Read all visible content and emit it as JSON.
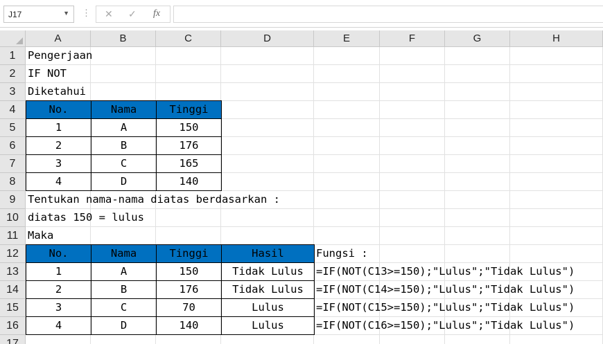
{
  "formula_bar": {
    "name_box": "J17",
    "cancel_icon": "✕",
    "enter_icon": "✓",
    "fx_label": "fx",
    "formula": ""
  },
  "columns": [
    "A",
    "B",
    "C",
    "D",
    "E",
    "F",
    "G",
    "H"
  ],
  "rows": [
    "1",
    "2",
    "3",
    "4",
    "5",
    "6",
    "7",
    "8",
    "9",
    "10",
    "11",
    "12",
    "13",
    "14",
    "15",
    "16",
    "17"
  ],
  "texts": {
    "r1": "Pengerjaan",
    "r2": "IF NOT",
    "r3": "Diketahui",
    "r9": "Tentukan nama-nama diatas berdasarkan :",
    "r10": "diatas 150 = lulus",
    "r11": "Maka",
    "e12": "Fungsi :"
  },
  "table1": {
    "headers": [
      "No.",
      "Nama",
      "Tinggi"
    ],
    "rows": [
      [
        "1",
        "A",
        "150"
      ],
      [
        "2",
        "B",
        "176"
      ],
      [
        "3",
        "C",
        "165"
      ],
      [
        "4",
        "D",
        "140"
      ]
    ]
  },
  "table2": {
    "headers": [
      "No.",
      "Nama",
      "Tinggi",
      "Hasil"
    ],
    "rows": [
      [
        "1",
        "A",
        "150",
        "Tidak Lulus"
      ],
      [
        "2",
        "B",
        "176",
        "Tidak Lulus"
      ],
      [
        "3",
        "C",
        "70",
        "Lulus"
      ],
      [
        "4",
        "D",
        "140",
        "Lulus"
      ]
    ]
  },
  "formulas": [
    "=IF(NOT(C13>=150);\"Lulus\";\"Tidak Lulus\")",
    "=IF(NOT(C14>=150);\"Lulus\";\"Tidak Lulus\")",
    "=IF(NOT(C15>=150);\"Lulus\";\"Tidak Lulus\")",
    "=IF(NOT(C16>=150);\"Lulus\";\"Tidak Lulus\")"
  ],
  "colors": {
    "header_fill": "#0070c0",
    "grid_line": "#e1e1e1",
    "heading_bg": "#e6e6e6"
  }
}
